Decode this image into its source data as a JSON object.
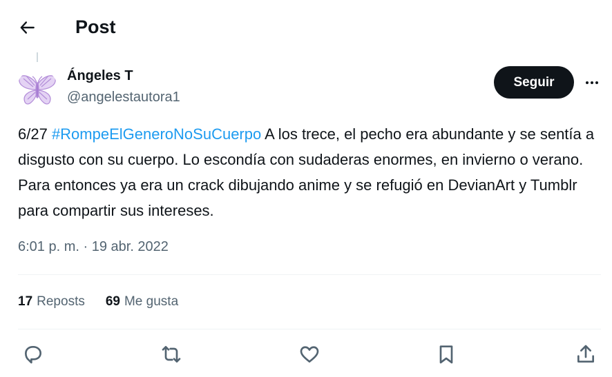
{
  "header": {
    "title": "Post",
    "back_icon": "arrow-left-icon"
  },
  "author": {
    "name": "Ángeles T",
    "handle": "@angelestautora1",
    "avatar": "butterfly-avatar"
  },
  "follow_button": {
    "label": "Seguir"
  },
  "more_icon": "more-horizontal-icon",
  "tweet": {
    "prefix": "6/27 ",
    "hashtag": "#RompeElGeneroNoSuCuerpo",
    "body": " A los trece, el pecho era abundante y se sentía a disgusto con su cuerpo. Lo escondía con sudaderas enormes, en invierno o verano. Para entonces ya era un crack dibujando anime y se refugió en DevianArt y Tumblr para compartir sus intereses."
  },
  "timestamp": "6:01 p. m. · 19 abr. 2022",
  "stats": {
    "reposts": {
      "count": "17",
      "label": "Reposts"
    },
    "likes": {
      "count": "69",
      "label": "Me gusta"
    }
  },
  "actions": [
    "reply-icon",
    "repost-icon",
    "like-icon",
    "bookmark-icon",
    "share-icon"
  ],
  "colors": {
    "accent": "#1d9bf0",
    "text": "#0f1419",
    "muted": "#536471",
    "avatar": "#c9aee6"
  }
}
